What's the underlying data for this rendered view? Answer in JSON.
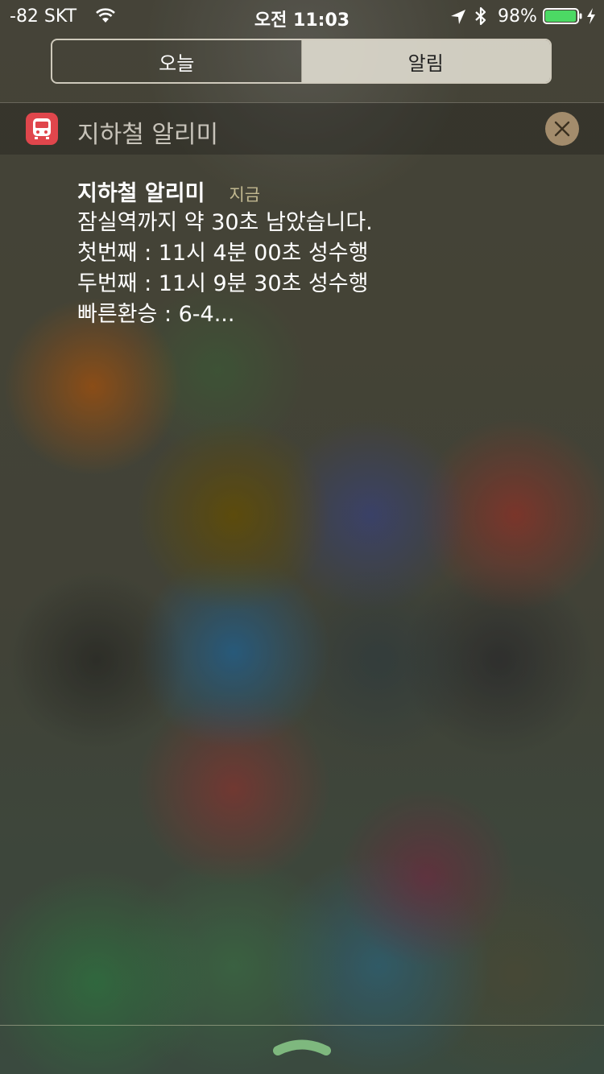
{
  "status_bar": {
    "carrier": "-82 SKT",
    "time": "오전 11:03",
    "battery_percent": "98%",
    "battery_level": 0.98,
    "battery_color": "#4cd964",
    "icons": [
      "wifi-icon",
      "location-arrow-icon",
      "bluetooth-icon",
      "battery-icon",
      "charging-bolt-icon"
    ]
  },
  "segmented_control": {
    "today_label": "오늘",
    "notifications_label": "알림",
    "selected": "알림"
  },
  "notification_group": {
    "app_name": "지하철 알리미",
    "app_icon": "subway-train-icon",
    "app_icon_color": "#e0464c",
    "clear_icon": "close-icon"
  },
  "notification": {
    "title": "지하철 알리미",
    "time": "지금",
    "lines": [
      "잠실역까지 약 30초 남았습니다.",
      "첫번째 : 11시 4분 00초 성수행",
      "두번째 : 11시 9분 30초 성수행",
      "빠른환승 : 6-4..."
    ]
  },
  "bottom": {
    "grabber_icon": "chevron-up-icon"
  }
}
